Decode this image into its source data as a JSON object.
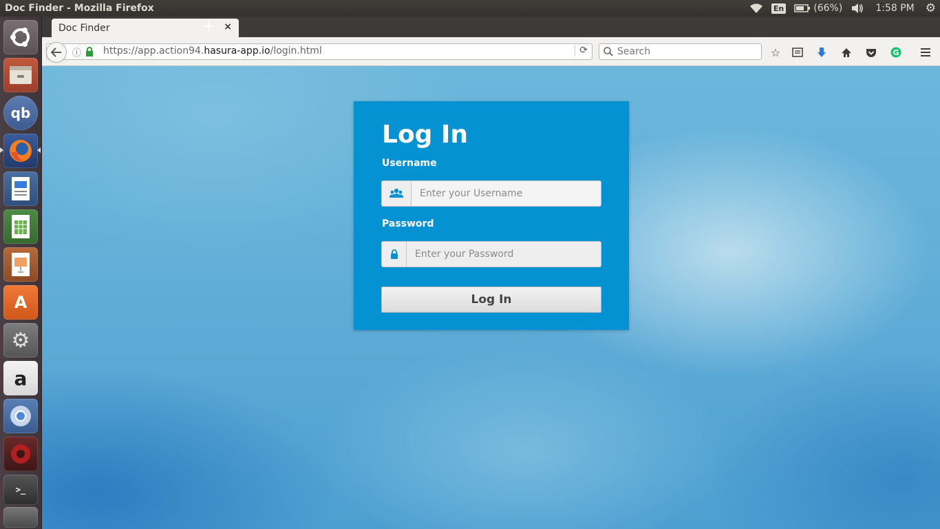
{
  "system": {
    "window_title": "Doc Finder - Mozilla Firefox",
    "language": "En",
    "battery": "(66%)",
    "time": "1:58 PM"
  },
  "launcher": {
    "items": [
      {
        "name": "ubuntu-dash-icon"
      },
      {
        "name": "files-icon"
      },
      {
        "name": "qbittorrent-icon",
        "glyph": "qb"
      },
      {
        "name": "firefox-icon"
      },
      {
        "name": "writer-icon"
      },
      {
        "name": "calc-icon"
      },
      {
        "name": "impress-icon"
      },
      {
        "name": "software-center-icon",
        "glyph": "A"
      },
      {
        "name": "system-settings-icon"
      },
      {
        "name": "amazon-icon",
        "glyph": "a"
      },
      {
        "name": "chromium-icon"
      },
      {
        "name": "app-red-icon"
      },
      {
        "name": "terminal-icon",
        "glyph": ">_"
      }
    ]
  },
  "browser": {
    "tab_title": "Doc Finder",
    "tab_close": "×",
    "new_tab": "+",
    "url_prefix": "https://app.action94.",
    "url_host": "hasura-app.io",
    "url_path": "/login.html",
    "search_placeholder": "Search"
  },
  "login": {
    "title": "Log In",
    "username_label": "Username",
    "username_placeholder": "Enter your Username",
    "password_label": "Password",
    "password_placeholder": "Enter your Password",
    "submit_label": "Log In"
  },
  "colors": {
    "card_bg": "#0592d3",
    "accent": "#0592d3"
  }
}
